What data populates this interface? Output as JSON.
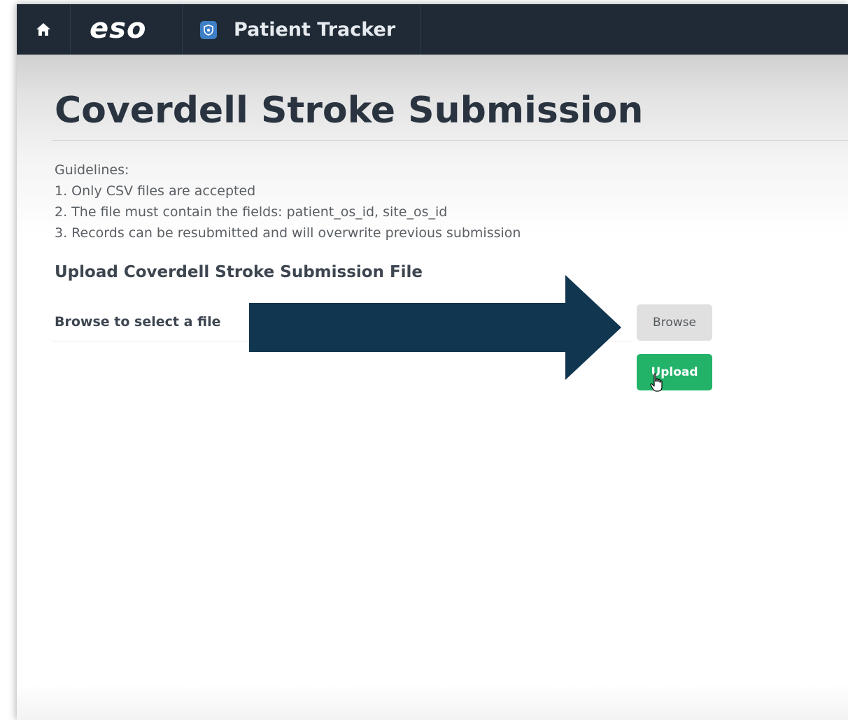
{
  "topbar": {
    "home_icon": "home-icon",
    "logo_text": "eso",
    "app_icon": "shield-icon",
    "app_title": "Patient Tracker"
  },
  "page": {
    "title": "Coverdell Stroke Submission"
  },
  "guidelines": {
    "heading": "Guidelines:",
    "items": [
      "1. Only CSV files are accepted",
      "2. The file must contain the fields: patient_os_id, site_os_id",
      "3. Records can be resubmitted and will overwrite previous submission"
    ]
  },
  "upload": {
    "heading": "Upload Coverdell Stroke Submission File",
    "browse_label": "Browse to select a file",
    "browse_button": "Browse",
    "upload_button": "Upload"
  },
  "colors": {
    "topbar": "#1f2a36",
    "app_icon": "#3e7fc6",
    "upload_button": "#22b369",
    "annotation_arrow": "#103650"
  }
}
